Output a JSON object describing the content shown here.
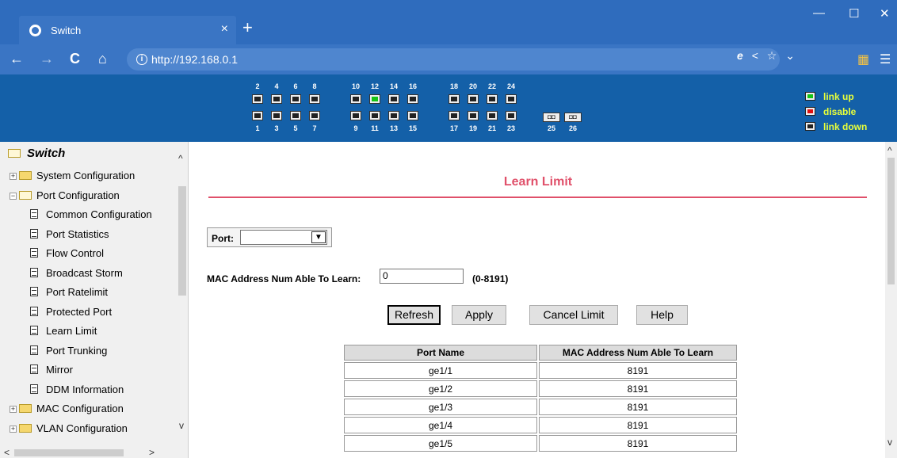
{
  "browser": {
    "tab_title": "Switch",
    "tab_close": "×",
    "new_tab": "+",
    "url": "http://192.168.0.1",
    "info_glyph": "i",
    "window_controls": {
      "minimize": "—",
      "maximize": "☐",
      "close": "✕"
    },
    "nav": {
      "back": "←",
      "forward": "→",
      "reload": "C",
      "home": "⌂"
    },
    "toolbar_icons": {
      "ie_mode": "e",
      "share": "<",
      "favorite": "☆",
      "dropdown": "⌄",
      "menu": "☰"
    }
  },
  "banner": {
    "top_labels": [
      "2",
      "4",
      "6",
      "8",
      "10",
      "12",
      "14",
      "16",
      "18",
      "20",
      "22",
      "24"
    ],
    "bottom_labels": [
      "1",
      "3",
      "5",
      "7",
      "9",
      "11",
      "13",
      "15",
      "17",
      "19",
      "21",
      "23"
    ],
    "sfp_labels": [
      "25",
      "26"
    ],
    "sfp_glyph": "◘◘",
    "legend": {
      "up": "link up",
      "disable": "disable",
      "down": "link down"
    },
    "colors": {
      "up": "#14c414",
      "disable": "#e01010",
      "down": "#222222"
    }
  },
  "sidebar": {
    "root": "Switch",
    "items": [
      {
        "label": "System Configuration",
        "type": "folder",
        "expander": "+"
      },
      {
        "label": "Port Configuration",
        "type": "folder-open",
        "expander": "−"
      },
      {
        "label": "Common Configuration",
        "type": "doc"
      },
      {
        "label": "Port Statistics",
        "type": "doc"
      },
      {
        "label": "Flow Control",
        "type": "doc"
      },
      {
        "label": "Broadcast Storm",
        "type": "doc"
      },
      {
        "label": "Port Ratelimit",
        "type": "doc"
      },
      {
        "label": "Protected Port",
        "type": "doc"
      },
      {
        "label": "Learn Limit",
        "type": "doc"
      },
      {
        "label": "Port Trunking",
        "type": "doc"
      },
      {
        "label": "Mirror",
        "type": "doc"
      },
      {
        "label": "DDM Information",
        "type": "doc"
      },
      {
        "label": "MAC Configuration",
        "type": "folder",
        "expander": "+"
      },
      {
        "label": "VLAN Configuration",
        "type": "folder",
        "expander": "+"
      }
    ],
    "scroll_arrows": {
      "up": "^",
      "down": "v",
      "left": "<",
      "right": ">"
    }
  },
  "main": {
    "title": "Learn Limit",
    "port_label": "Port:",
    "port_value": "",
    "port_dropdown": "▼",
    "mac_label": "MAC Address Num Able To Learn:",
    "mac_value": "0",
    "mac_range": "(0-8191)",
    "buttons": {
      "refresh": "Refresh",
      "apply": "Apply",
      "cancel": "Cancel Limit",
      "help": "Help"
    },
    "table": {
      "headers": [
        "Port Name",
        "MAC Address Num Able To Learn"
      ],
      "rows": [
        [
          "ge1/1",
          "8191"
        ],
        [
          "ge1/2",
          "8191"
        ],
        [
          "ge1/3",
          "8191"
        ],
        [
          "ge1/4",
          "8191"
        ],
        [
          "ge1/5",
          "8191"
        ]
      ]
    },
    "scroll_arrows": {
      "up": "^",
      "down": "v"
    }
  },
  "colors": {
    "accent": "#e0506a",
    "banner": "#1460a8",
    "chrome": "#2f6cbd",
    "legend_text": "#e8ff3a"
  }
}
